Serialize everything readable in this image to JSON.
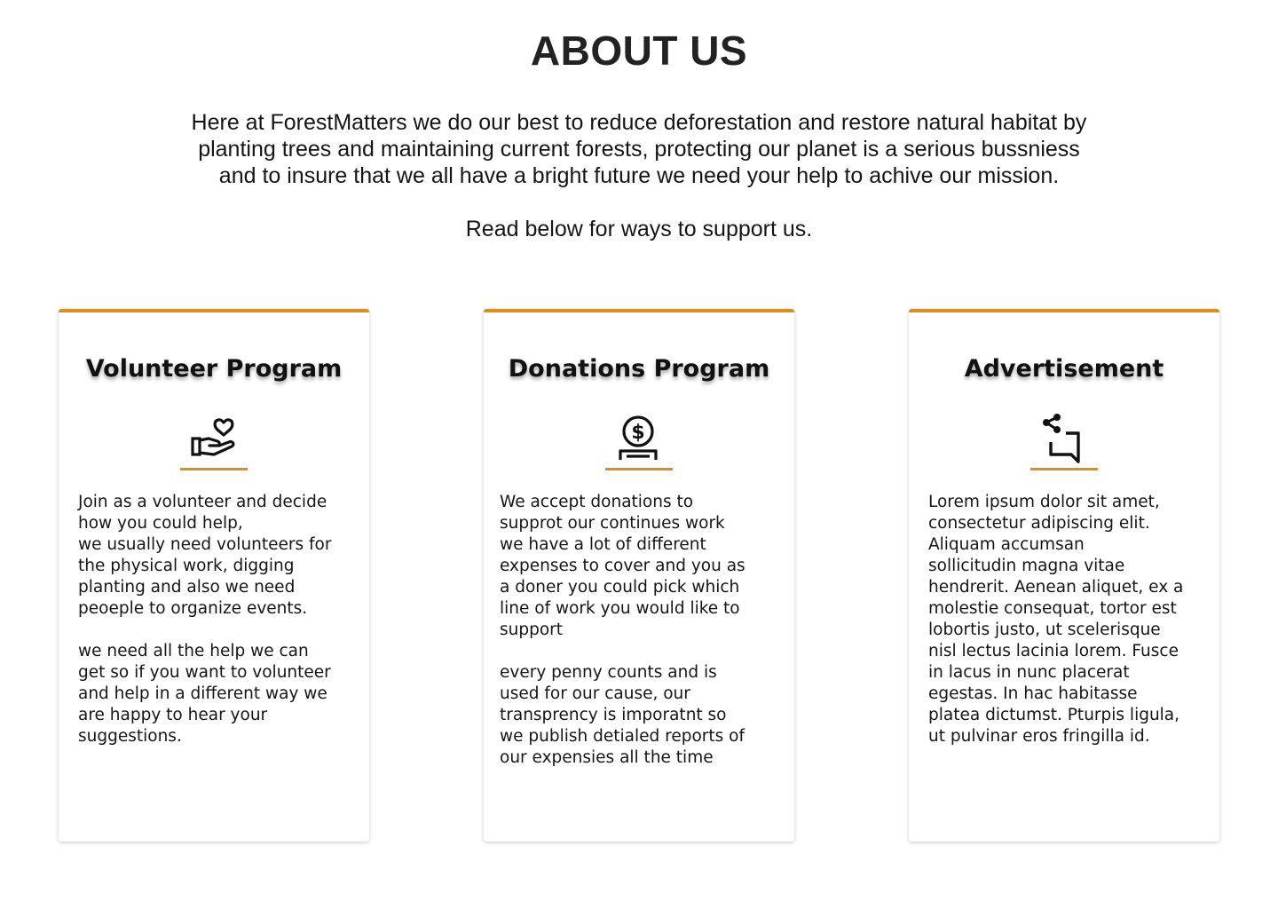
{
  "header": {
    "title": "ABOUT US",
    "intro": "Here at  ForestMatters we do our best to reduce deforestation and restore natural habitat by\nplanting trees and maintaining current forests, protecting our planet is a serious bussniess\nand to insure that we all have a bright future we need your help to achive our mission.",
    "support_line": "Read below for ways to support us."
  },
  "accent_color": "#d88f1f",
  "cards": [
    {
      "title": "Volunteer Program",
      "icon": "hand-heart-icon",
      "body": "Join as a volunteer and decide\nhow you could help,\nwe usually need volunteers for\nthe physical work, digging\nplanting and also we need\npeoeple to organize events.\n\nwe need all the help we can\nget so if you want to volunteer\nand help in a different way we\nare happy to hear your\nsuggestions."
    },
    {
      "title": "Donations Program",
      "icon": "coin-dollar-icon",
      "body": "We accept donations to\nsupprot our continues work\nwe have a lot of different\nexpenses to cover and you as\na doner you could pick which\nline of work you would like to\nsupport\n\nevery penny counts and is\nused for our cause, our\ntransprency is imporatnt so\nwe publish detialed reports of\nour expensies all the time"
    },
    {
      "title": "Advertisement",
      "icon": "share-message-icon",
      "body": "Lorem ipsum dolor sit amet,\nconsectetur adipiscing elit.\nAliquam accumsan\nsollicitudin magna vitae\nhendrerit. Aenean aliquet, ex a\nmolestie consequat, tortor est\nlobortis justo, ut scelerisque\nnisl lectus lacinia lorem. Fusce\nin lacus in nunc placerat\negestas. In hac habitasse\nplatea dictumst. Pturpis ligula,\nut pulvinar eros fringilla id."
    }
  ]
}
